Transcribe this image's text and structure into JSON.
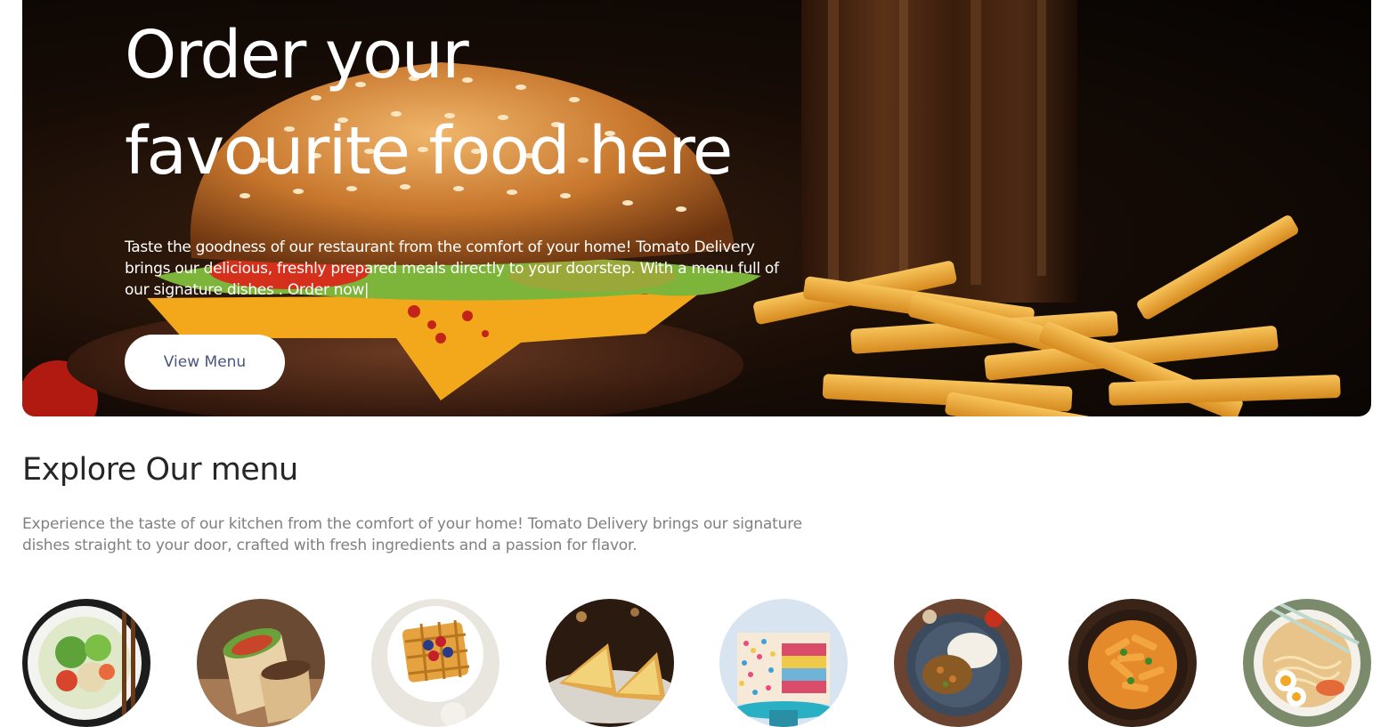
{
  "hero": {
    "title_line1": "Order your",
    "title_line2": "favourite food here",
    "description": "Taste the goodness of our restaurant from the comfort of your home! Tomato Delivery brings our delicious, freshly prepared meals directly to your doorstep. With a menu full of our signature dishes . Order now|",
    "button_label": "View Menu"
  },
  "explore": {
    "title": "Explore Our menu",
    "text": "Experience the taste of our kitchen from the comfort of your home! Tomato Delivery brings our signature dishes straight to your door, crafted with fresh ingredients and a passion for flavor.",
    "items": [
      {
        "icon": "salad-image"
      },
      {
        "icon": "rolls-image"
      },
      {
        "icon": "desserts-image"
      },
      {
        "icon": "sandwich-image"
      },
      {
        "icon": "cake-image"
      },
      {
        "icon": "pure-veg-image"
      },
      {
        "icon": "pasta-image"
      },
      {
        "icon": "noodles-image"
      }
    ]
  },
  "colors": {
    "button_text": "#49557e",
    "heading": "#262626",
    "body_text": "#808080"
  }
}
